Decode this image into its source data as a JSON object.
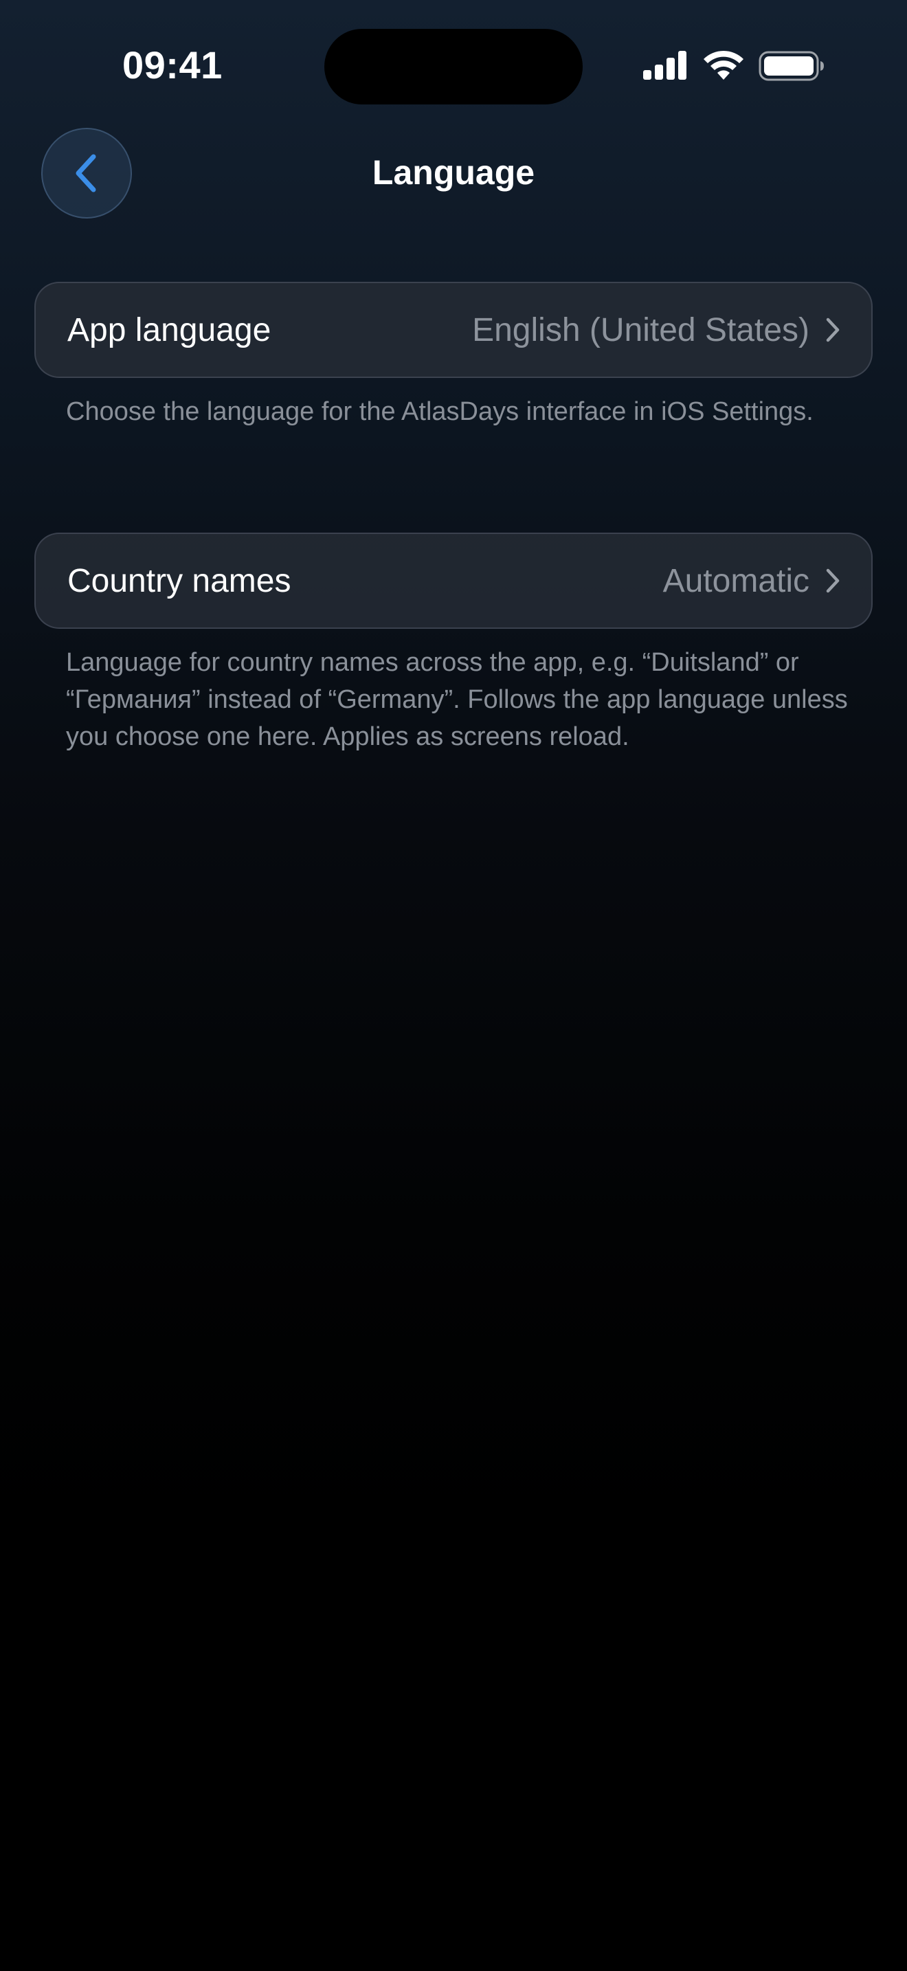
{
  "status_bar": {
    "time": "09:41",
    "icons": [
      "cellular-signal-icon",
      "wifi-icon",
      "battery-icon"
    ]
  },
  "nav": {
    "back_icon": "chevron-left-icon",
    "title": "Language"
  },
  "settings": {
    "app_language": {
      "label": "App language",
      "value": "English (United States)",
      "footnote": "Choose the language for the AtlasDays interface in iOS Settings."
    },
    "country_names": {
      "label": "Country names",
      "value": "Automatic",
      "footnote": "Language for country names across the app, e.g. “Duitsland” or “Германия” instead of “Germany”. Follows the app language unless you choose one here. Applies as screens reload."
    }
  },
  "colors": {
    "accent": "#3b8ee8",
    "row_background": "#262c36",
    "secondary_text": "#8a9099"
  }
}
